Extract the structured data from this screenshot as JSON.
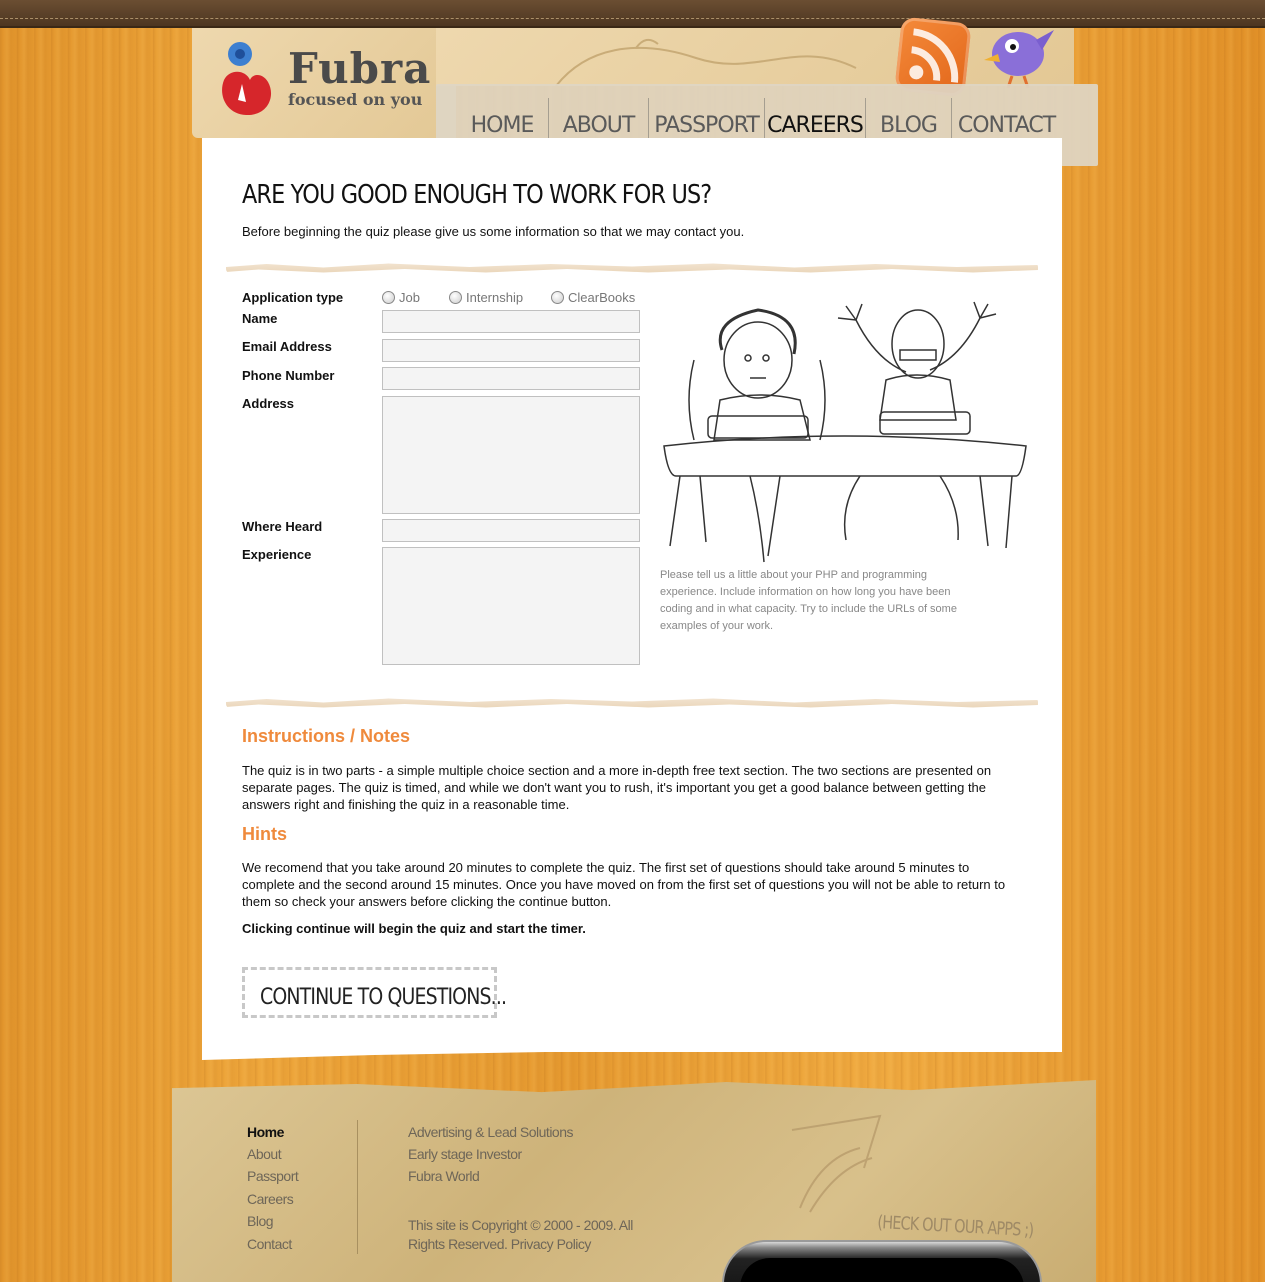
{
  "brand": {
    "name": "Fubra",
    "tagline": "focused on you"
  },
  "nav": {
    "items": [
      {
        "label": "HOME"
      },
      {
        "label": "ABOUT"
      },
      {
        "label": "PASSPORT"
      },
      {
        "label": "CAREERS"
      },
      {
        "label": "BLOG"
      },
      {
        "label": "CONTACT"
      }
    ],
    "active": "CAREERS"
  },
  "header_icons": [
    "rss-icon",
    "twitter-bird-icon"
  ],
  "page": {
    "title": "ARE YOU GOOD ENOUGH TO WORK FOR US?",
    "intro": "Before beginning the quiz please give us some information so that we may contact you."
  },
  "form": {
    "application_type_label": "Application type",
    "options": [
      "Job",
      "Internship",
      "ClearBooks"
    ],
    "name_label": "Name",
    "email_label": "Email Address",
    "phone_label": "Phone Number",
    "address_label": "Address",
    "where_heard_label": "Where Heard",
    "experience_label": "Experience",
    "experience_hint": "Please tell us a little about your PHP and programming experience. Include information on how long you have been coding and in what capacity. Try to include the URLs of some examples of your work."
  },
  "instructions": {
    "heading": "Instructions / Notes",
    "text": "The quiz is in two parts - a simple multiple choice section and a more in-depth free text section. The two sections are presented on separate pages. The quiz is timed, and while we don't want you to rush, it's important you get a good balance between getting the answers right and finishing the quiz in a reasonable time."
  },
  "hints": {
    "heading": "Hints",
    "text": "We recomend that you take around 20 minutes to complete the quiz. The first set of questions should take around 5 minutes to complete and the second around 15 minutes. Once you have moved on from the first set of questions you will not be able to return to them so check your answers before clicking the continue button.",
    "warning": "Clicking continue will begin the quiz and start the timer."
  },
  "continue_label": "CONTINUE TO QUESTIONS...",
  "footer": {
    "nav": [
      "Home",
      "About",
      "Passport",
      "Careers",
      "Blog",
      "Contact"
    ],
    "links": [
      "Advertising & Lead Solutions",
      "Early stage Investor",
      "Fubra World"
    ],
    "copyright_text": "This site is Copyright © 2000 - 2009. All Rights Reserved.",
    "privacy_label": "Privacy Policy",
    "apps_label": "(HECK OUT OUR APPS ;)"
  },
  "colors": {
    "accent_orange": "#ef8a3c",
    "wood": "#e89c32",
    "paper": "#e3c895"
  }
}
